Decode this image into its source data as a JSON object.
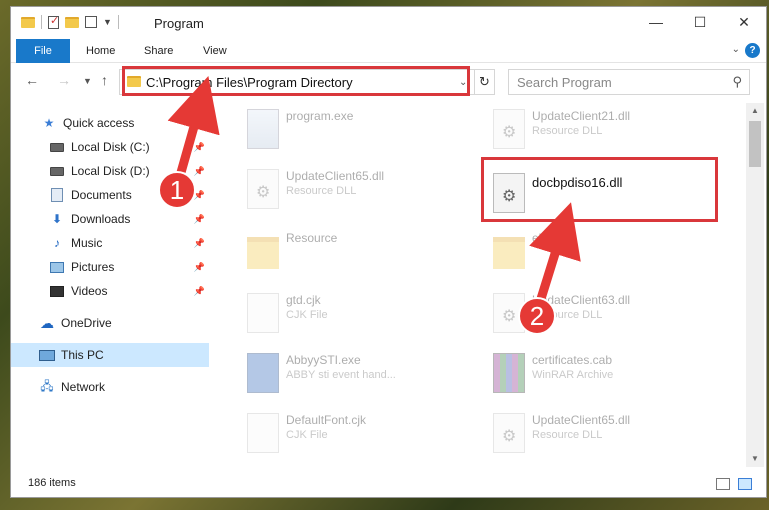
{
  "window": {
    "title": "Program",
    "controls": {
      "minimize": "—",
      "maximize": "☐",
      "close": "✕"
    }
  },
  "ribbon": {
    "tabs": [
      {
        "label": "File"
      },
      {
        "label": "Home"
      },
      {
        "label": "Share"
      },
      {
        "label": "View"
      }
    ],
    "accent": "#1979ca"
  },
  "address": {
    "path": "C:\\Program Files\\Program Directory"
  },
  "search": {
    "placeholder": "Search Program"
  },
  "nav": {
    "items": [
      {
        "label": "Quick access",
        "icon": "star-icon",
        "pinned": false
      },
      {
        "label": "Local Disk (C:)",
        "icon": "drive-icon",
        "pinned": true
      },
      {
        "label": "Local Disk (D:)",
        "icon": "drive-icon",
        "pinned": true
      },
      {
        "label": "Documents",
        "icon": "documents-icon",
        "pinned": true
      },
      {
        "label": "Downloads",
        "icon": "download-icon",
        "pinned": true
      },
      {
        "label": "Music",
        "icon": "music-icon",
        "pinned": true
      },
      {
        "label": "Pictures",
        "icon": "pictures-icon",
        "pinned": true
      },
      {
        "label": "Videos",
        "icon": "videos-icon",
        "pinned": true
      },
      {
        "label": "OneDrive",
        "icon": "cloud-icon",
        "pinned": false
      },
      {
        "label": "This PC",
        "icon": "computer-icon",
        "pinned": false,
        "selected": true
      },
      {
        "label": "Network",
        "icon": "network-icon",
        "pinned": false
      }
    ]
  },
  "files": [
    {
      "name": "program.exe",
      "type": ""
    },
    {
      "name": "UpdateClient21.dll",
      "type": "Resource DLL"
    },
    {
      "name": "UpdateClient65.dll",
      "type": "Resource DLL"
    },
    {
      "name": "docbpdiso16.dll",
      "type": ""
    },
    {
      "name": "Resource",
      "type": ""
    },
    {
      "name": "el",
      "type": ""
    },
    {
      "name": "gtd.cjk",
      "type": "CJK File"
    },
    {
      "name": "UpdateClient63.dll",
      "type": "Resource DLL"
    },
    {
      "name": "AbbyySTI.exe",
      "type": "ABBY sti event hand..."
    },
    {
      "name": "certificates.cab",
      "type": "WinRAR Archive"
    },
    {
      "name": "DefaultFont.cjk",
      "type": "CJK File"
    },
    {
      "name": "UpdateClient65.dll",
      "type": "Resource DLL"
    }
  ],
  "status": {
    "item_count": "186 items"
  },
  "annotations": {
    "step1": "1",
    "step2": "2",
    "color": "#e53935"
  }
}
